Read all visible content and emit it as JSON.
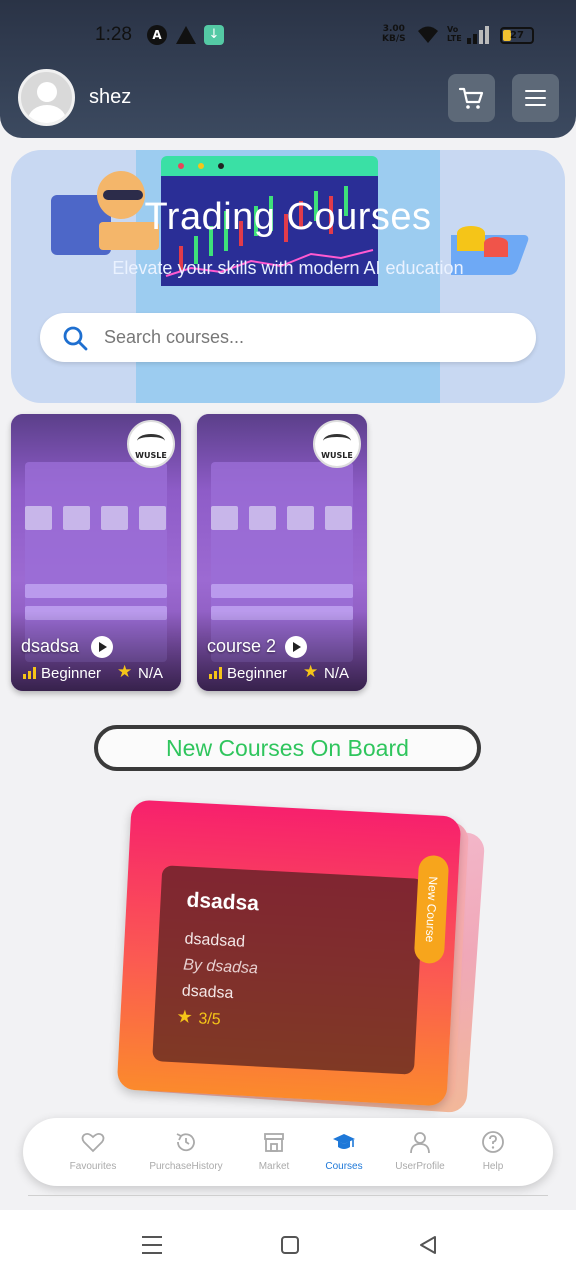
{
  "status_bar": {
    "time": "1:28",
    "network_speed": "3.00\nKB/S",
    "volte": "Vo\nLTE",
    "battery": "27"
  },
  "header": {
    "username": "shez",
    "icons": [
      "avatar-icon",
      "cart-icon",
      "menu-icon"
    ]
  },
  "hero": {
    "title": "Trading Courses",
    "subtitle": "Elevate your skills with modern AI education",
    "search_placeholder": "Search courses..."
  },
  "courses": [
    {
      "name": "dsadsa",
      "level": "Beginner",
      "rating": "N/A",
      "logo_text": "WUSLE"
    },
    {
      "name": "course 2",
      "level": "Beginner",
      "rating": "N/A",
      "logo_text": "WUSLE"
    }
  ],
  "new_courses_banner": "New Courses On Board",
  "featured": {
    "title": "dsadsa",
    "description": "dsadsad",
    "author": "By dsadsa",
    "category": "dsadsa",
    "rating": "3/5",
    "tag": "New Course"
  },
  "bottom_nav": {
    "active": "Courses",
    "items": [
      {
        "label": "Favourites",
        "icon": "heart-icon"
      },
      {
        "label": "PurchaseHistory",
        "icon": "history-icon"
      },
      {
        "label": "Market",
        "icon": "store-icon"
      },
      {
        "label": "Courses",
        "icon": "graduation-cap-icon"
      },
      {
        "label": "UserProfile",
        "icon": "user-icon"
      },
      {
        "label": "Help",
        "icon": "help-icon"
      }
    ]
  },
  "colors": {
    "header_bg": "#2a3346",
    "accent_green": "#2fc55d",
    "nav_active": "#1e78d8",
    "featured_top": "#f7206d",
    "featured_bottom": "#fb8a2c"
  }
}
